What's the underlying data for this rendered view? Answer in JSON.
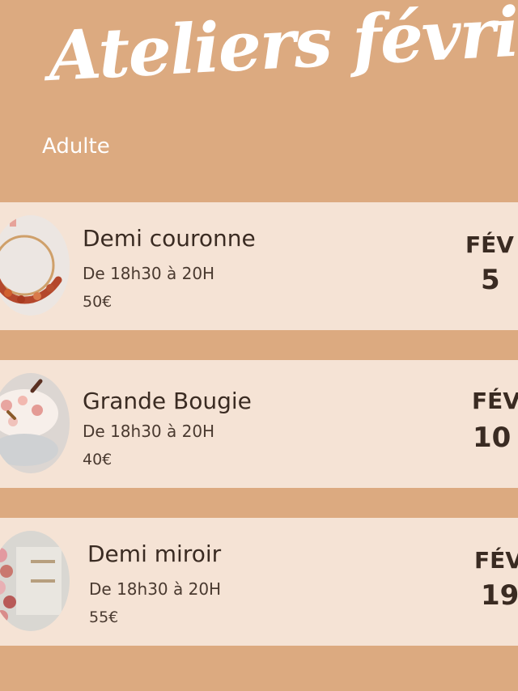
{
  "header": {
    "title": "Ateliers février",
    "subtitle": "Adulte"
  },
  "workshops": [
    {
      "name": "Demi couronne",
      "time": "De 18h30 à 20H",
      "price": "50€",
      "month": "FÉV",
      "day": "5",
      "image_icon": "dried-flower-wreath-icon"
    },
    {
      "name": "Grande Bougie",
      "time": "De 18h30 à 20H",
      "price": "40€",
      "month": "FÉV",
      "day": "10",
      "image_icon": "flower-candle-icon"
    },
    {
      "name": "Demi miroir",
      "time": "De 18h30 à 20H",
      "price": "55€",
      "month": "FÉV",
      "day": "19",
      "image_icon": "flower-mirror-icon"
    }
  ],
  "colors": {
    "background": "#dcaa80",
    "card": "#f5e3d5",
    "text": "#3a2b22"
  }
}
